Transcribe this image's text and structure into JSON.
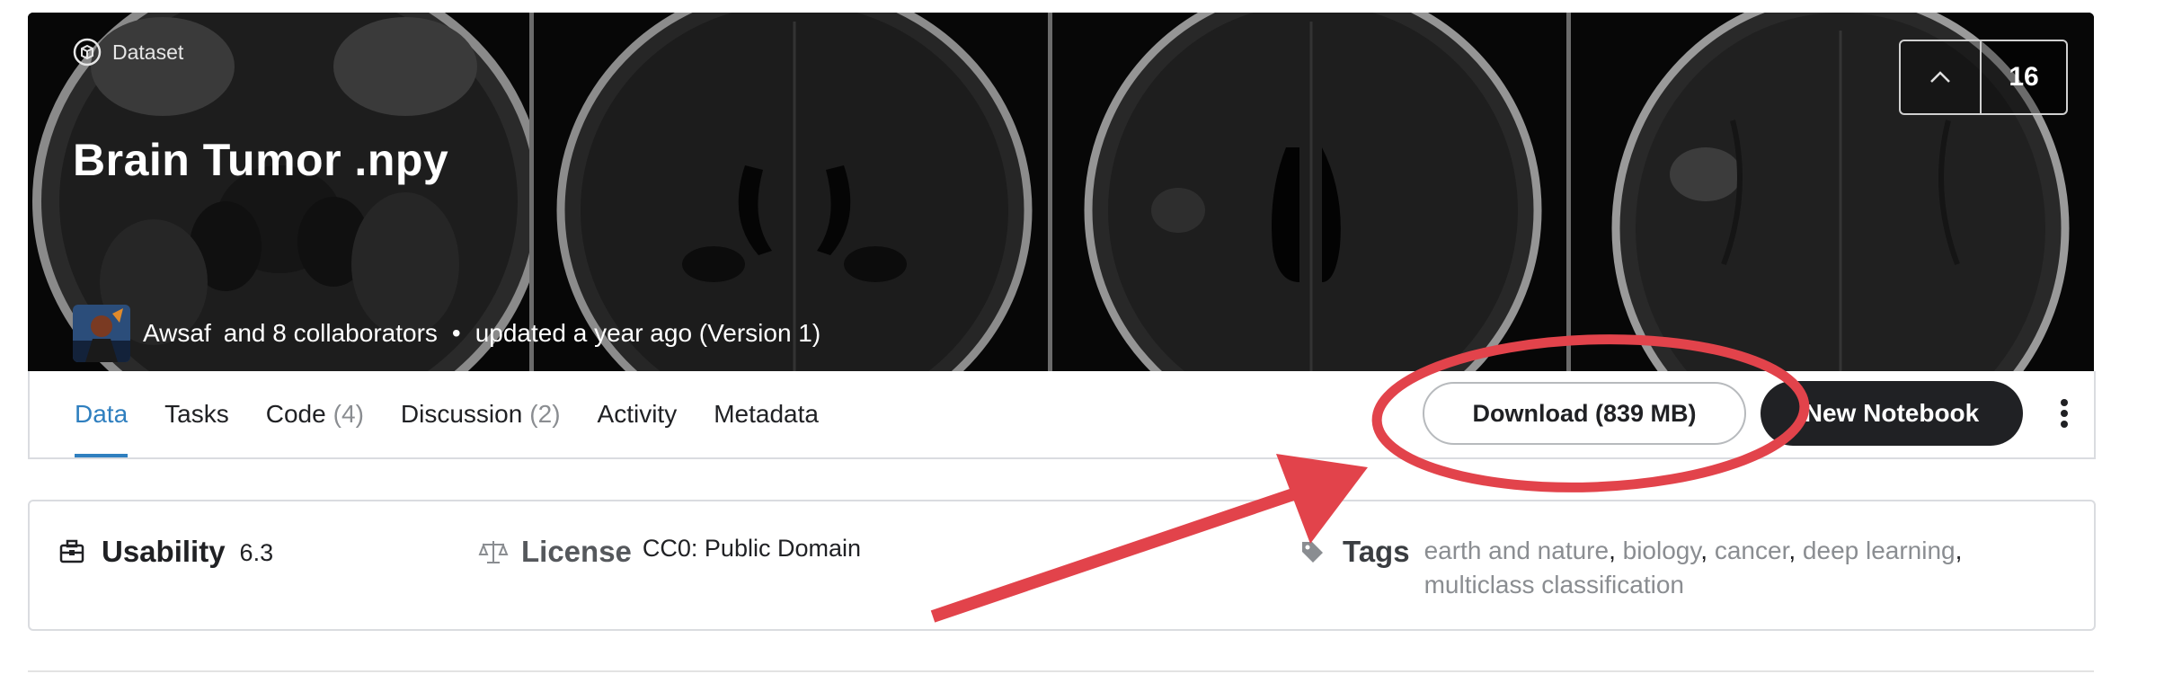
{
  "hero": {
    "type_label": "Dataset",
    "title": "Brain Tumor .npy",
    "upvote_count": "16",
    "author": "Awsaf",
    "collaborators": "and 8 collaborators",
    "bullet": "•",
    "updated": "updated a year ago (Version 1)"
  },
  "tabs": [
    {
      "label": "Data",
      "count": ""
    },
    {
      "label": "Tasks",
      "count": ""
    },
    {
      "label": "Code",
      "count": "(4)"
    },
    {
      "label": "Discussion",
      "count": "(2)"
    },
    {
      "label": "Activity",
      "count": ""
    },
    {
      "label": "Metadata",
      "count": ""
    }
  ],
  "actions": {
    "download": "Download (839 MB)",
    "new_notebook": "New Notebook"
  },
  "info": {
    "usability_label": "Usability",
    "usability_value": "6.3",
    "license_label": "License",
    "license_value": "CC0: Public Domain",
    "tags_label": "Tags",
    "tags": [
      "earth and nature",
      "biology",
      "cancer",
      "deep learning",
      "multiclass classification"
    ]
  },
  "colors": {
    "accent_tab": "#2f7fbf",
    "annotation_red": "#e2434b",
    "button_dark": "#202124"
  },
  "icons": [
    "dataset-icon",
    "chevron-up-icon",
    "more-vert-icon",
    "usability-icon",
    "scale-icon",
    "tag-icon"
  ]
}
